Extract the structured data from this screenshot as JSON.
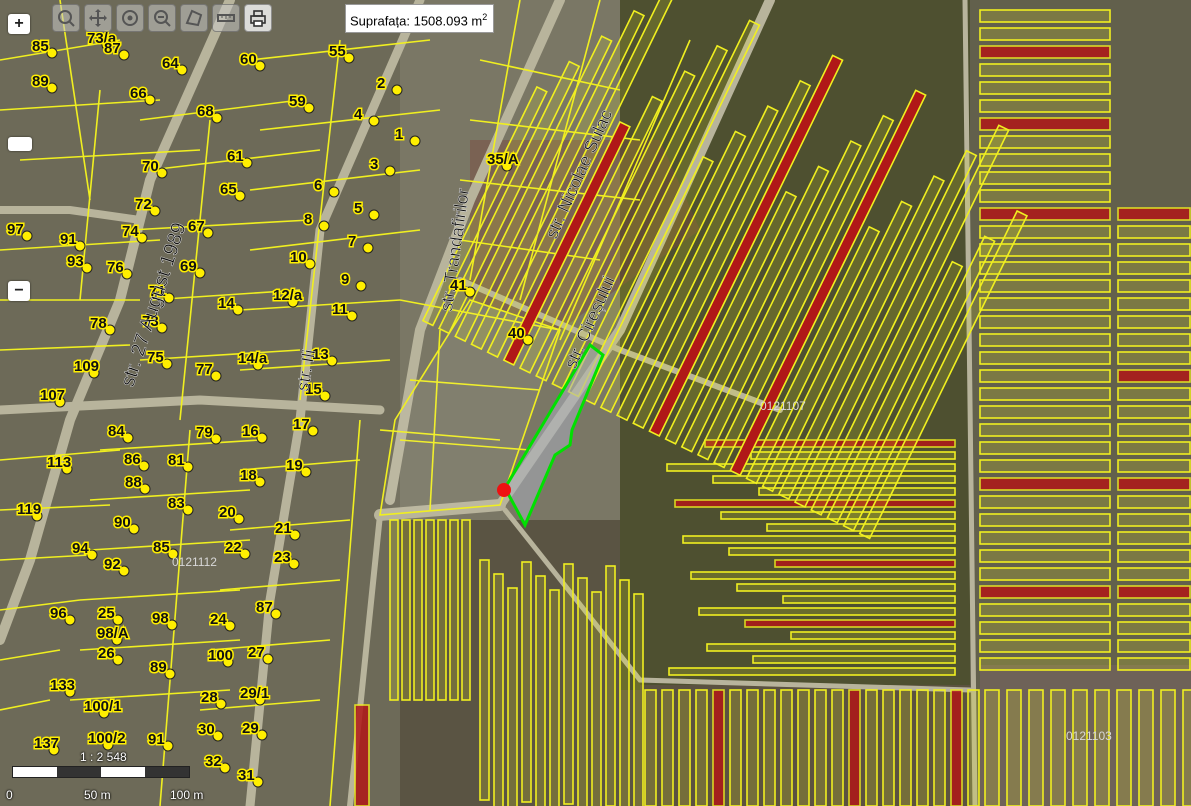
{
  "toolbar": {
    "tools": [
      {
        "name": "zoom-box-icon"
      },
      {
        "name": "pan-icon"
      },
      {
        "name": "target-icon"
      },
      {
        "name": "zoom-out-box-icon"
      },
      {
        "name": "measure-area-icon"
      },
      {
        "name": "measure-line-icon"
      },
      {
        "name": "print-icon"
      }
    ]
  },
  "measure": {
    "label": "Suprafața: 1508.093 m",
    "unit_exp": "2"
  },
  "zoom": {
    "in": "+",
    "mid": "",
    "out": "−"
  },
  "scale": {
    "ratio": "1 : 2 548",
    "ticks": [
      "0",
      "50 m",
      "100 m"
    ]
  },
  "streets": [
    {
      "text": "str. Nicolae Sulac"
    },
    {
      "text": "str. Trandafirilor"
    },
    {
      "text": "str. Cireșului"
    },
    {
      "text": "str. 27 August 1989"
    },
    {
      "text": "str. Ili"
    }
  ],
  "cadastral_labels": [
    "0121107",
    "0121112",
    "0121103"
  ],
  "parcel_numbers": [
    "85",
    "73/a",
    "87",
    "64",
    "60",
    "55",
    "89",
    "66",
    "68",
    "59",
    "2",
    "4",
    "1",
    "35/A",
    "3",
    "70",
    "61",
    "65",
    "6",
    "72",
    "5",
    "97",
    "91",
    "74",
    "67",
    "8",
    "7",
    "93",
    "76",
    "69",
    "10",
    "9",
    "71",
    "14",
    "12/a",
    "41",
    "78",
    "73",
    "11",
    "40",
    "109",
    "75",
    "77",
    "14/a",
    "13",
    "107",
    "15",
    "84",
    "79",
    "16",
    "17",
    "113",
    "86",
    "81",
    "88",
    "18",
    "19",
    "119",
    "83",
    "90",
    "20",
    "21",
    "94",
    "85",
    "22",
    "92",
    "23",
    "96",
    "98",
    "87",
    "24",
    "25",
    "98/A",
    "100",
    "26",
    "27",
    "89",
    "133",
    "28",
    "29/1",
    "100/1",
    "30",
    "29",
    "137",
    "100/2",
    "91",
    "32",
    "31"
  ],
  "colors": {
    "parcel_line": "#f0ef20",
    "point": "#ffef00",
    "highlight": "#00e000",
    "marker": "#ee1111",
    "red_strip": "#b01818"
  }
}
